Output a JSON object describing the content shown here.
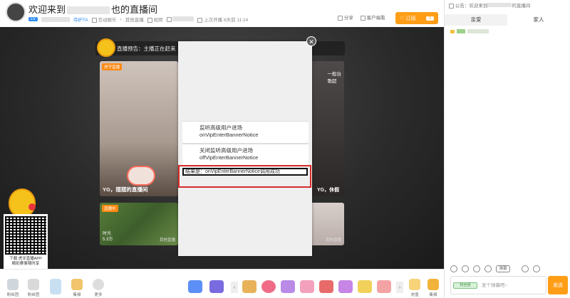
{
  "header": {
    "title_prefix": "欢迎来到",
    "title_suffix": "也的直播间",
    "level_badge": "LV",
    "rank_tag": "夺护TA",
    "category": "互动娱乐",
    "subcategory": "其他直播",
    "screen_label": "视频",
    "last_live": "上次开播 6天前 11:14",
    "share_label": "分享",
    "client_label": "客户端看",
    "subscribe_label": "订阅",
    "subscribe_count": "0"
  },
  "video": {
    "preview_text": "直播预告：主播正在赶来",
    "cards": [
      {
        "tag": "虎守直播",
        "label": "YG，摆摆的直播间"
      },
      {
        "sub_line1": "一般台",
        "sub_line2": "歌超",
        "label": "YG，休假"
      },
      {
        "tag": "直播中",
        "line1": "时光",
        "line2": "5.3万",
        "caption": "其他直播"
      },
      {
        "caption": "其他直播"
      }
    ]
  },
  "popup": {
    "close_glyph": "✕",
    "item1_line1": "监听高级用户进场",
    "item1_line2": "onVipEnterBannerNotice",
    "item2_line1": "关闭监听高级用户进场",
    "item2_line2": "offVipEnterBannerNotice",
    "result": "结果是：onVipEnterBannerNotice调用成功"
  },
  "qr": {
    "caption_line1": "下载 虎牙直播APP",
    "caption_line2": "精彩赛事随时享"
  },
  "bottom_bar": {
    "items": [
      "粉丝团",
      "粉丝团",
      "",
      "集禄",
      "更多"
    ],
    "right_items": [
      "充值",
      "集禄"
    ],
    "left_arrow": "‹",
    "right_arrow": "›"
  },
  "panel": {
    "notice_prefix": "公告：欢迎来到",
    "notice_suffix": "的直播间",
    "tabs": [
      "亲爱",
      "家人"
    ],
    "tool_pill": "弹幕",
    "fan_badge": "粉丝团",
    "input_placeholder": "发个弹幕吧~",
    "send_label": "发送"
  },
  "colors": {
    "accent": "#ff9d16",
    "highlight": "#d82a2a",
    "link": "#2f8cf2"
  }
}
